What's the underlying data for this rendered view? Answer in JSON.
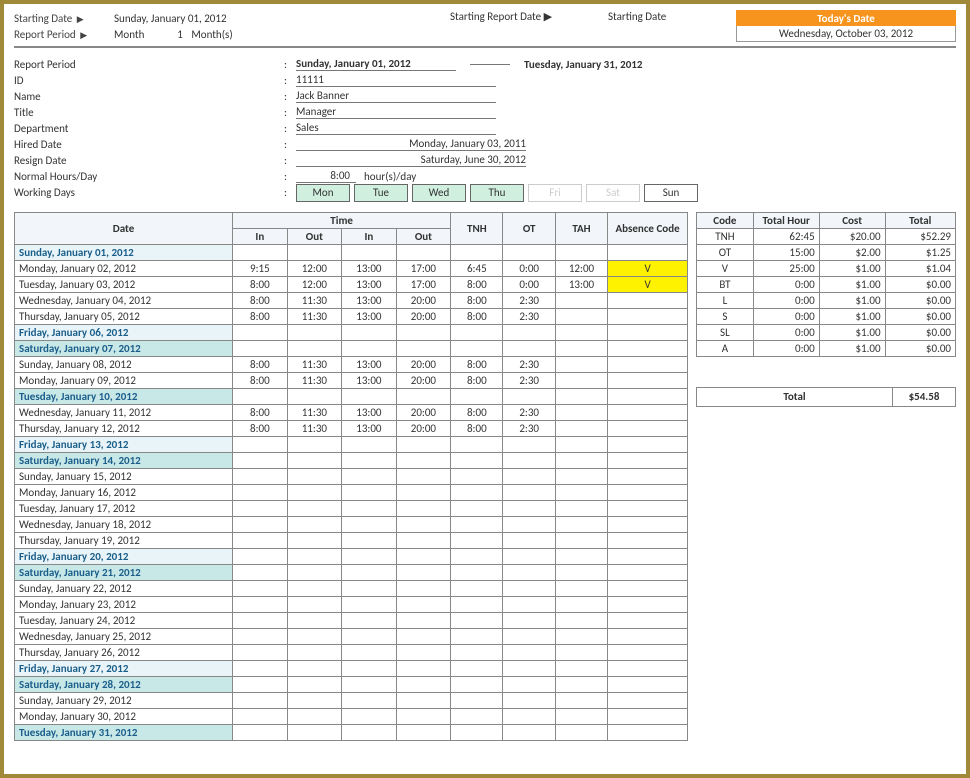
{
  "top": {
    "starting_date_lbl": "Starting Date",
    "starting_date_val": "Sunday, January 01, 2012",
    "report_period_lbl": "Report Period",
    "period_unit": "Month",
    "period_num": "1",
    "period_unit2": "Month(s)",
    "start_rep_lbl": "Starting Report Date",
    "start_rep_lbl2": "Starting Date",
    "today_hdr": "Today's Date",
    "today_val": "Wednesday, October 03, 2012"
  },
  "meta": {
    "rp_lbl": "Report Period",
    "rp_from": "Sunday, January 01, 2012",
    "rp_to": "Tuesday, January 31, 2012",
    "id_lbl": "ID",
    "id_val": "11111",
    "name_lbl": "Name",
    "name_val": "Jack Banner",
    "title_lbl": "Title",
    "title_val": "Manager",
    "dept_lbl": "Department",
    "dept_val": "Sales",
    "hired_lbl": "Hired Date",
    "hired_val": "Monday, January 03, 2011",
    "resign_lbl": "Resign Date",
    "resign_val": "Saturday, June 30, 2012",
    "nh_lbl": "Normal Hours/Day",
    "nh_val": "8:00",
    "nh_unit": "hour(s)/day",
    "wd_lbl": "Working Days"
  },
  "days": [
    {
      "label": "Mon",
      "cls": "wk"
    },
    {
      "label": "Tue",
      "cls": "wk"
    },
    {
      "label": "Wed",
      "cls": "wk"
    },
    {
      "label": "Thu",
      "cls": "wk"
    },
    {
      "label": "Fri",
      "cls": "off"
    },
    {
      "label": "Sat",
      "cls": "off"
    },
    {
      "label": "Sun",
      "cls": ""
    }
  ],
  "ts_headers": {
    "date": "Date",
    "time": "Time",
    "in": "In",
    "out": "Out",
    "tnh": "TNH",
    "ot": "OT",
    "tah": "TAH",
    "abs": "Absence Code"
  },
  "ts_rows": [
    {
      "date": "Sunday, January 01, 2012",
      "sp": "sp"
    },
    {
      "date": "Monday, January 02, 2012",
      "i1": "9:15",
      "o1": "12:00",
      "i2": "13:00",
      "o2": "17:00",
      "tnh": "6:45",
      "ot": "0:00",
      "tah": "12:00",
      "abs": "V"
    },
    {
      "date": "Tuesday, January 03, 2012",
      "i1": "8:00",
      "o1": "12:00",
      "i2": "13:00",
      "o2": "17:00",
      "tnh": "8:00",
      "ot": "0:00",
      "tah": "13:00",
      "abs": "V"
    },
    {
      "date": "Wednesday, January 04, 2012",
      "i1": "8:00",
      "o1": "11:30",
      "i2": "13:00",
      "o2": "20:00",
      "tnh": "8:00",
      "ot": "2:30",
      "tah": "",
      "abs": ""
    },
    {
      "date": "Thursday, January 05, 2012",
      "i1": "8:00",
      "o1": "11:30",
      "i2": "13:00",
      "o2": "20:00",
      "tnh": "8:00",
      "ot": "2:30",
      "tah": "",
      "abs": ""
    },
    {
      "date": "Friday, January 06, 2012",
      "sp": "sp"
    },
    {
      "date": "Saturday, January 07, 2012",
      "sp": "sp2"
    },
    {
      "date": "Sunday, January 08, 2012",
      "i1": "8:00",
      "o1": "11:30",
      "i2": "13:00",
      "o2": "20:00",
      "tnh": "8:00",
      "ot": "2:30",
      "tah": "",
      "abs": ""
    },
    {
      "date": "Monday, January 09, 2012",
      "i1": "8:00",
      "o1": "11:30",
      "i2": "13:00",
      "o2": "20:00",
      "tnh": "8:00",
      "ot": "2:30",
      "tah": "",
      "abs": ""
    },
    {
      "date": "Tuesday, January 10, 2012",
      "sp": "sp2"
    },
    {
      "date": "Wednesday, January 11, 2012",
      "i1": "8:00",
      "o1": "11:30",
      "i2": "13:00",
      "o2": "20:00",
      "tnh": "8:00",
      "ot": "2:30",
      "tah": "",
      "abs": ""
    },
    {
      "date": "Thursday, January 12, 2012",
      "i1": "8:00",
      "o1": "11:30",
      "i2": "13:00",
      "o2": "20:00",
      "tnh": "8:00",
      "ot": "2:30",
      "tah": "",
      "abs": ""
    },
    {
      "date": "Friday, January 13, 2012",
      "sp": "sp"
    },
    {
      "date": "Saturday, January 14, 2012",
      "sp": "sp2"
    },
    {
      "date": "Sunday, January 15, 2012"
    },
    {
      "date": "Monday, January 16, 2012"
    },
    {
      "date": "Tuesday, January 17, 2012"
    },
    {
      "date": "Wednesday, January 18, 2012"
    },
    {
      "date": "Thursday, January 19, 2012"
    },
    {
      "date": "Friday, January 20, 2012",
      "sp": "sp"
    },
    {
      "date": "Saturday, January 21, 2012",
      "sp": "sp2"
    },
    {
      "date": "Sunday, January 22, 2012"
    },
    {
      "date": "Monday, January 23, 2012"
    },
    {
      "date": "Tuesday, January 24, 2012"
    },
    {
      "date": "Wednesday, January 25, 2012"
    },
    {
      "date": "Thursday, January 26, 2012"
    },
    {
      "date": "Friday, January 27, 2012",
      "sp": "sp"
    },
    {
      "date": "Saturday, January 28, 2012",
      "sp": "sp2"
    },
    {
      "date": "Sunday, January 29, 2012"
    },
    {
      "date": "Monday, January 30, 2012"
    },
    {
      "date": "Tuesday, January 31, 2012",
      "sp": "sp2"
    }
  ],
  "sum_headers": {
    "code": "Code",
    "th": "Total Hour",
    "cost": "Cost",
    "total": "Total"
  },
  "sum_rows": [
    {
      "code": "TNH",
      "th": "62:45",
      "cost": "$20.00",
      "total": "$52.29"
    },
    {
      "code": "OT",
      "th": "15:00",
      "cost": "$2.00",
      "total": "$1.25"
    },
    {
      "code": "V",
      "th": "25:00",
      "cost": "$1.00",
      "total": "$1.04"
    },
    {
      "code": "BT",
      "th": "0:00",
      "cost": "$1.00",
      "total": "$0.00"
    },
    {
      "code": "L",
      "th": "0:00",
      "cost": "$1.00",
      "total": "$0.00"
    },
    {
      "code": "S",
      "th": "0:00",
      "cost": "$1.00",
      "total": "$0.00"
    },
    {
      "code": "SL",
      "th": "0:00",
      "cost": "$1.00",
      "total": "$0.00"
    },
    {
      "code": "A",
      "th": "0:00",
      "cost": "$1.00",
      "total": "$0.00"
    }
  ],
  "sum_total": {
    "lbl": "Total",
    "val": "$54.58"
  }
}
